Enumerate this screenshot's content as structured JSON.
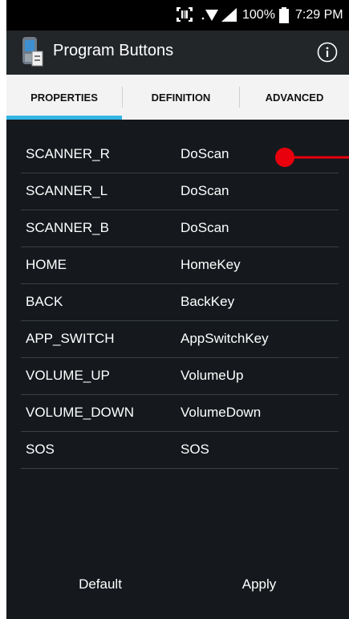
{
  "status_bar": {
    "battery_percent": "100%",
    "time": "7:29 PM",
    "icons": [
      "barcode-scan-icon",
      "wifi-icon",
      "signal-icon",
      "battery-icon"
    ]
  },
  "app_bar": {
    "title": "Program Buttons",
    "app_icon": "scanner-device-icon",
    "info_icon": "info-icon"
  },
  "tabs": [
    {
      "label": "PROPERTIES",
      "selected": true
    },
    {
      "label": "DEFINITION",
      "selected": false
    },
    {
      "label": "ADVANCED",
      "selected": false
    }
  ],
  "mappings": [
    {
      "key": "SCANNER_R",
      "value": "DoScan"
    },
    {
      "key": "SCANNER_L",
      "value": "DoScan"
    },
    {
      "key": "SCANNER_B",
      "value": "DoScan"
    },
    {
      "key": "HOME",
      "value": "HomeKey"
    },
    {
      "key": "BACK",
      "value": "BackKey"
    },
    {
      "key": "APP_SWITCH",
      "value": "AppSwitchKey"
    },
    {
      "key": "VOLUME_UP",
      "value": "VolumeUp"
    },
    {
      "key": "VOLUME_DOWN",
      "value": "VolumeDown"
    },
    {
      "key": "SOS",
      "value": "SOS"
    }
  ],
  "buttons": {
    "default_label": "Default",
    "apply_label": "Apply"
  },
  "colors": {
    "background": "#15191d",
    "tab_indicator": "#33b5e5",
    "marker": "#e8000d"
  }
}
